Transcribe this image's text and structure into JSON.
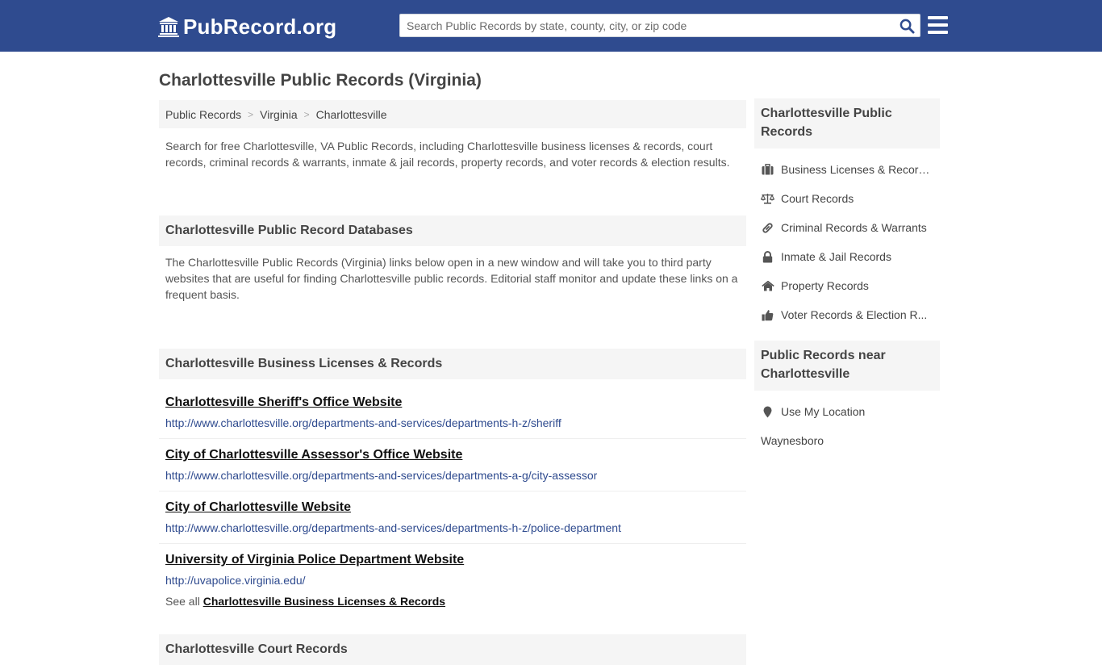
{
  "header": {
    "logo_text": "PubRecord.org",
    "search_placeholder": "Search Public Records by state, county, city, or zip code"
  },
  "page_title": "Charlottesville Public Records (Virginia)",
  "breadcrumb": [
    "Public Records",
    "Virginia",
    "Charlottesville"
  ],
  "intro": "Search for free Charlottesville, VA Public Records, including Charlottesville business licenses & records, court records, criminal records & warrants, inmate & jail records, property records, and voter records & election results.",
  "databases": {
    "heading": "Charlottesville Public Record Databases",
    "description": "The Charlottesville Public Records (Virginia) links below open in a new window and will take you to third party websites that are useful for finding Charlottesville public records. Editorial staff monitor and update these links on a frequent basis."
  },
  "business": {
    "heading": "Charlottesville Business Licenses & Records",
    "records": [
      {
        "title": "Charlottesville Sheriff's Office Website",
        "url": "http://www.charlottesville.org/departments-and-services/departments-h-z/sheriff"
      },
      {
        "title": "City of Charlottesville Assessor's Office Website",
        "url": "http://www.charlottesville.org/departments-and-services/departments-a-g/city-assessor"
      },
      {
        "title": "City of Charlottesville Website",
        "url": "http://www.charlottesville.org/departments-and-services/departments-h-z/police-department"
      },
      {
        "title": "University of Virginia Police Department Website",
        "url": "http://uvapolice.virginia.edu/"
      }
    ],
    "see_all_prefix": "See all",
    "see_all_link": "Charlottesville Business Licenses & Records"
  },
  "court": {
    "heading": "Charlottesville Court Records"
  },
  "sidebar": {
    "records_heading": "Charlottesville Public Records",
    "items": [
      {
        "label": "Business Licenses & Records",
        "icon": "briefcase-icon"
      },
      {
        "label": "Court Records",
        "icon": "balance-scale-icon"
      },
      {
        "label": "Criminal Records & Warrants",
        "icon": "link-icon"
      },
      {
        "label": "Inmate & Jail Records",
        "icon": "lock-icon"
      },
      {
        "label": "Property Records",
        "icon": "home-icon"
      },
      {
        "label": "Voter Records & Election R...",
        "icon": "thumbs-up-icon"
      }
    ],
    "near_heading": "Public Records near Charlottesville",
    "use_location": "Use My Location",
    "nearby": [
      "Waynesboro"
    ]
  },
  "colors": {
    "header_bg": "#2f4b8f",
    "panel_bg": "#f5f5f5",
    "link_url": "#2f4b8f"
  }
}
